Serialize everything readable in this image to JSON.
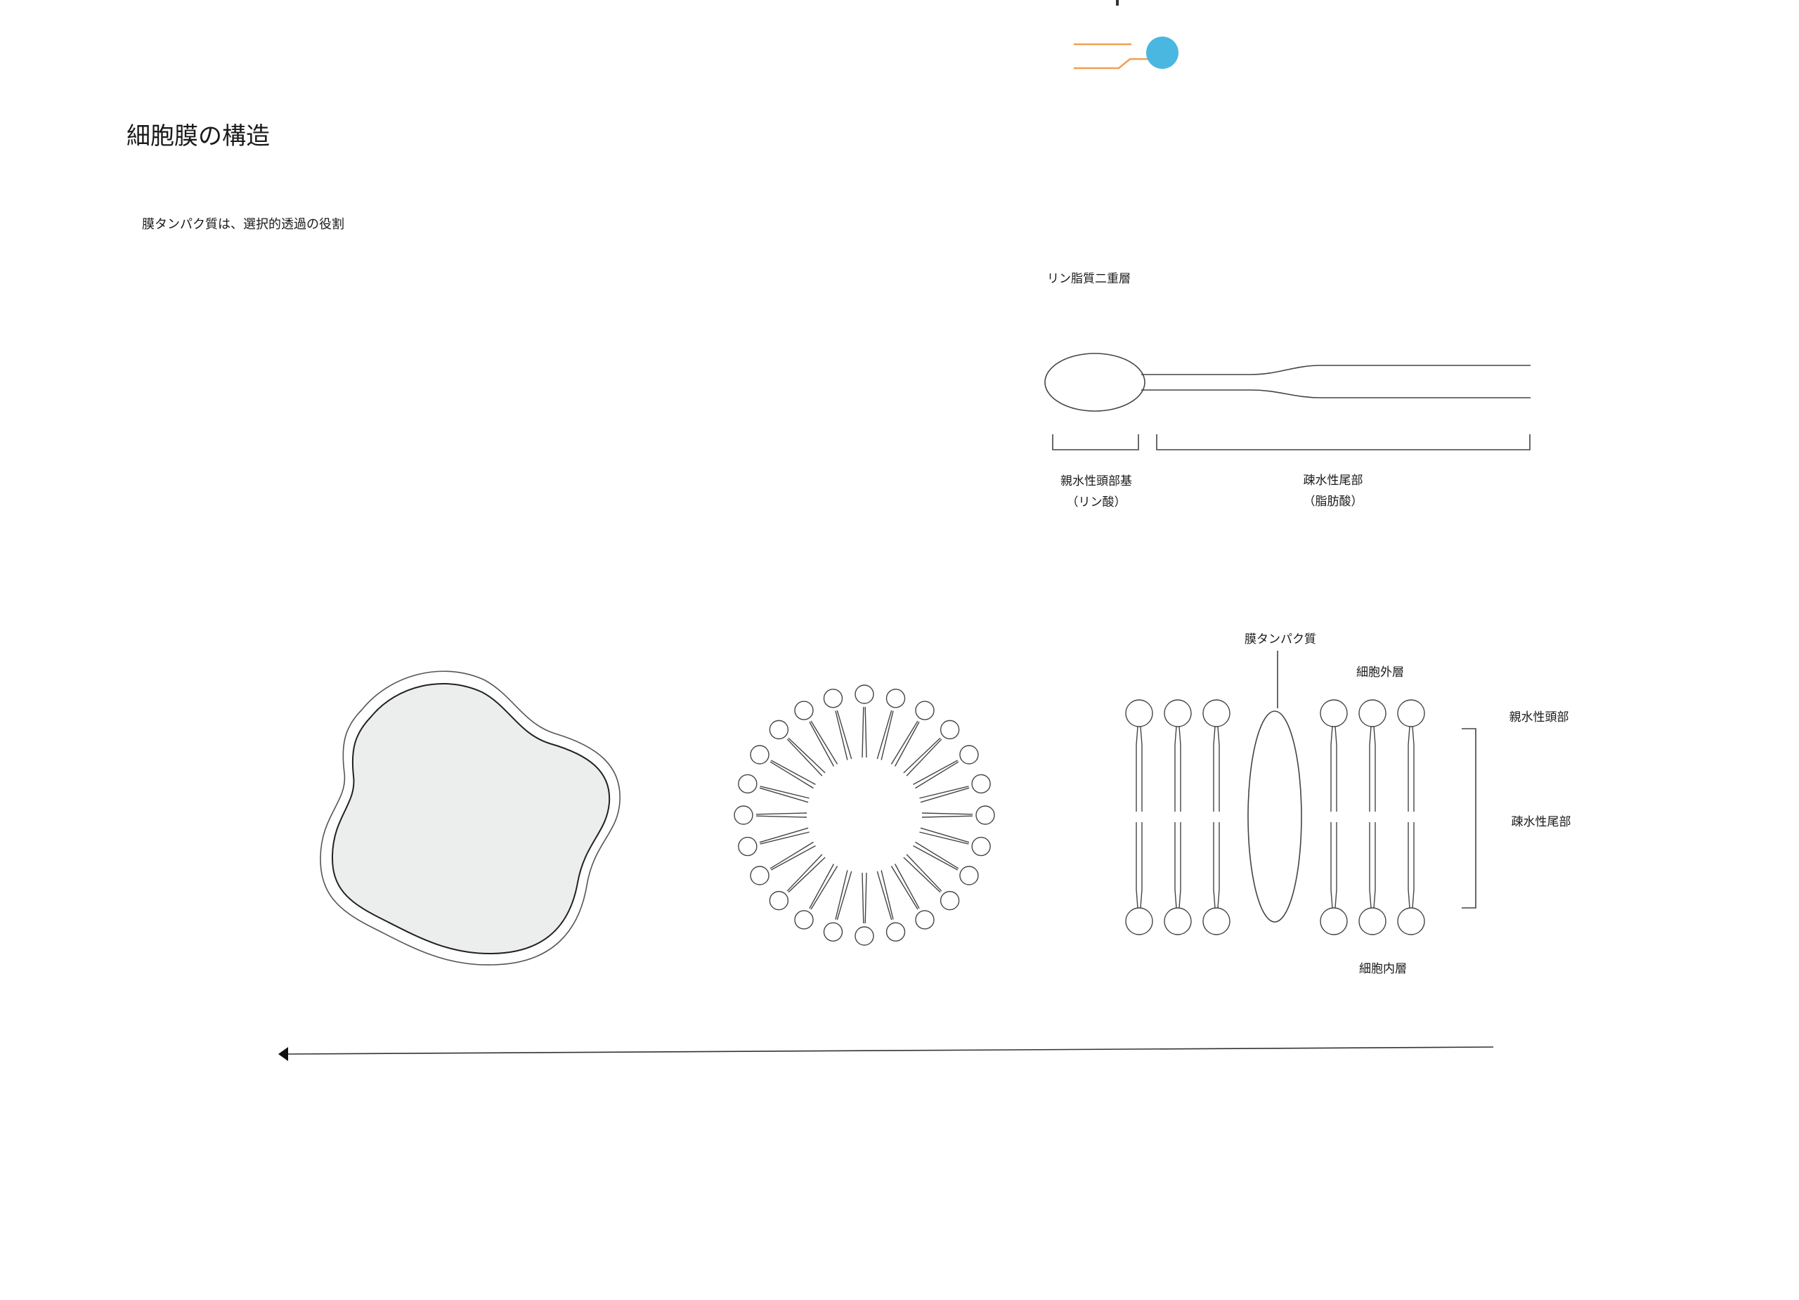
{
  "header": {
    "title": "細胞膜の構造",
    "caption": "膜タンパク質は、選択的透過の役割"
  },
  "colors": {
    "accent_dot": "#4ab7e0",
    "accent_lines": "#f0a050",
    "stroke": "#333333",
    "cell_fill": "#eceeee"
  },
  "phospholipid": {
    "title": "リン脂質二重層",
    "head_label": "親水性頭部基",
    "head_sub": "（リン酸）",
    "tail_label": "疎水性尾部",
    "tail_sub": "（脂肪酸）"
  },
  "bilayer": {
    "protein_label": "膜タンパク質",
    "outer_label": "細胞外層",
    "inner_label": "細胞内層",
    "head_label": "親水性頭部",
    "tail_label": "疎水性尾部"
  }
}
